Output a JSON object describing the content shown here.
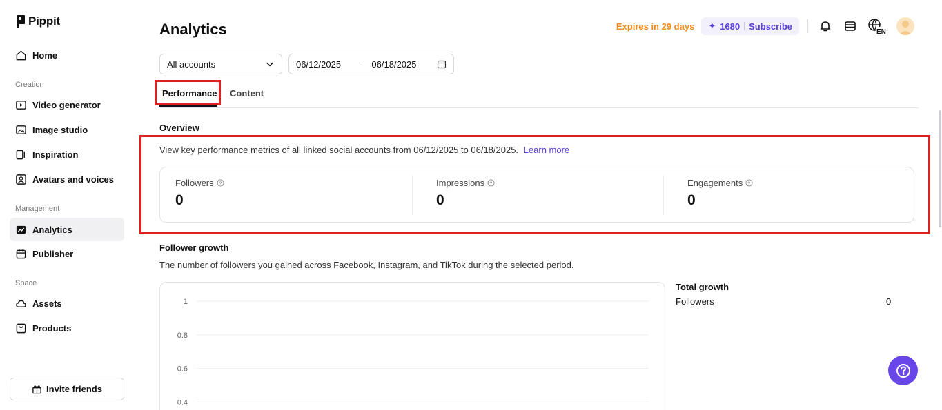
{
  "app": {
    "name": "Pippit"
  },
  "sidebar": {
    "home": "Home",
    "sections": {
      "creation": "Creation",
      "management": "Management",
      "space": "Space"
    },
    "items": {
      "video_generator": "Video generator",
      "image_studio": "Image studio",
      "inspiration": "Inspiration",
      "avatars_voices": "Avatars and voices",
      "analytics": "Analytics",
      "publisher": "Publisher",
      "assets": "Assets",
      "products": "Products"
    },
    "active": "Analytics",
    "invite": "Invite friends"
  },
  "header": {
    "title": "Analytics",
    "expires": "Expires in 29 days",
    "credits": "1680",
    "subscribe": "Subscribe",
    "language": "EN"
  },
  "filters": {
    "account": "All accounts",
    "start_date": "06/12/2025",
    "separator": "-",
    "end_date": "06/18/2025"
  },
  "tabs": {
    "performance": "Performance",
    "content": "Content",
    "active": "Performance"
  },
  "overview": {
    "heading": "Overview",
    "description": "View key performance metrics of all linked social accounts from 06/12/2025 to 06/18/2025.",
    "learn_more": "Learn more",
    "metrics": [
      {
        "label": "Followers",
        "value": "0"
      },
      {
        "label": "Impressions",
        "value": "0"
      },
      {
        "label": "Engagements",
        "value": "0"
      }
    ]
  },
  "follower_growth": {
    "heading": "Follower growth",
    "description": "The number of followers you gained across Facebook, Instagram, and TikTok during the selected period.",
    "total_growth_title": "Total growth",
    "total_rows": [
      {
        "label": "Followers",
        "value": "0"
      }
    ]
  },
  "chart_data": {
    "type": "line",
    "title": "",
    "xlabel": "",
    "ylabel": "",
    "y_ticks": [
      "1",
      "0.8",
      "0.6",
      "0.4"
    ],
    "ylim": [
      0.4,
      1
    ],
    "series": [],
    "grid": true
  },
  "colors": {
    "accent": "#5b3fd6",
    "warning": "#f08a1c",
    "highlight": "#e0201f",
    "help_button": "#6846ea"
  }
}
